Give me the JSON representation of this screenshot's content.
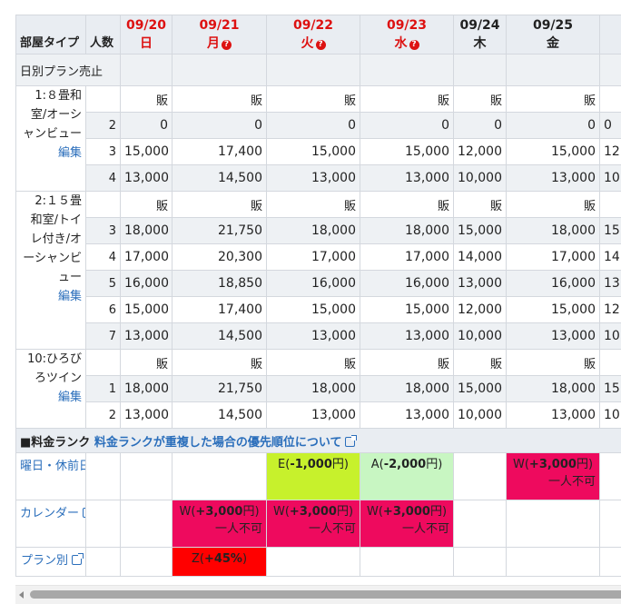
{
  "header": {
    "room_type": "部屋タイプ",
    "persons": "人数",
    "dates": [
      {
        "date": "09/20",
        "weekday": "日",
        "color": "red",
        "has_q": false
      },
      {
        "date": "09/21",
        "weekday": "月",
        "color": "red",
        "has_q": true
      },
      {
        "date": "09/22",
        "weekday": "火",
        "color": "red",
        "has_q": true
      },
      {
        "date": "09/23",
        "weekday": "水",
        "color": "red",
        "has_q": true
      },
      {
        "date": "09/24",
        "weekday": "木",
        "color": "blk",
        "has_q": false
      },
      {
        "date": "09/25",
        "weekday": "金",
        "color": "blk",
        "has_q": false
      },
      {
        "date": "09",
        "weekday": "",
        "color": "blu",
        "has_q": false
      }
    ]
  },
  "daily_plan_label": "日別プラン売止",
  "sell_label": "販",
  "edit_label": "編集",
  "rooms": [
    {
      "name": "1:８畳和室/オーシャンビュー",
      "lines": [
        "1:８畳和",
        "室/オーシ",
        "ャンビュー"
      ],
      "rows": [
        {
          "persons": "2",
          "values": [
            "0",
            "0",
            "0",
            "0",
            "0",
            "0",
            "0"
          ]
        },
        {
          "persons": "3",
          "values": [
            "15,000",
            "17,400",
            "15,000",
            "15,000",
            "12,000",
            "15,000",
            "12"
          ]
        },
        {
          "persons": "4",
          "values": [
            "13,000",
            "14,500",
            "13,000",
            "13,000",
            "10,000",
            "13,000",
            "10"
          ]
        }
      ]
    },
    {
      "name": "2:１５畳和室/トイレ付き/オーシャンビュー",
      "lines": [
        "2:１５畳",
        "和室/トイ",
        "レ付き/オ",
        "ーシャンビ",
        "ュー"
      ],
      "rows": [
        {
          "persons": "3",
          "values": [
            "18,000",
            "21,750",
            "18,000",
            "18,000",
            "15,000",
            "18,000",
            "15"
          ]
        },
        {
          "persons": "4",
          "values": [
            "17,000",
            "20,300",
            "17,000",
            "17,000",
            "14,000",
            "17,000",
            "14"
          ]
        },
        {
          "persons": "5",
          "values": [
            "16,000",
            "18,850",
            "16,000",
            "16,000",
            "13,000",
            "16,000",
            "13"
          ]
        },
        {
          "persons": "6",
          "values": [
            "15,000",
            "17,400",
            "15,000",
            "15,000",
            "12,000",
            "15,000",
            "12"
          ]
        },
        {
          "persons": "7",
          "values": [
            "13,000",
            "14,500",
            "13,000",
            "13,000",
            "10,000",
            "13,000",
            "10"
          ]
        }
      ]
    },
    {
      "name": "10:ひろびろツイン",
      "lines": [
        "10:ひろび",
        "ろツイン"
      ],
      "rows": [
        {
          "persons": "1",
          "values": [
            "18,000",
            "21,750",
            "18,000",
            "18,000",
            "15,000",
            "18,000",
            "15"
          ]
        },
        {
          "persons": "2",
          "values": [
            "13,000",
            "14,500",
            "13,000",
            "13,000",
            "10,000",
            "13,000",
            "10"
          ]
        }
      ]
    }
  ],
  "rank_section": {
    "title": "■料金ランク",
    "link": "料金ランクが重複した場合の優先順位について"
  },
  "rank_rows": [
    {
      "label": "曜日・休前日",
      "cells": [
        null,
        null,
        {
          "text": "E(-1,000円)",
          "bold": "-1,000",
          "pre": "E(",
          "post": "円)",
          "color": "yellow"
        },
        {
          "text": "A(-2,000円)",
          "bold": "-2,000",
          "pre": "A(",
          "post": "円)",
          "color": "lgreen"
        },
        null,
        {
          "text": "W(+3,000円)",
          "bold": "+3,000",
          "pre": "W(",
          "post": "円)",
          "sub": "一人不可",
          "color": "pink"
        },
        null
      ]
    },
    {
      "label": "カレンダー",
      "cells": [
        null,
        {
          "text": "W(+3,000円)",
          "bold": "+3,000",
          "pre": "W(",
          "post": "円)",
          "sub": "一人不可",
          "color": "pink"
        },
        {
          "text": "W(+3,000円)",
          "bold": "+3,000",
          "pre": "W(",
          "post": "円)",
          "sub": "一人不可",
          "color": "pink"
        },
        {
          "text": "W(+3,000円)",
          "bold": "+3,000",
          "pre": "W(",
          "post": "円)",
          "sub": "一人不可",
          "color": "pink"
        },
        null,
        null,
        null
      ]
    },
    {
      "label": "プラン別",
      "cells": [
        null,
        {
          "text": "Z(+45%)",
          "bold": "+45%",
          "pre": "Z(",
          "post": ")",
          "color": "red"
        },
        null,
        null,
        null,
        null,
        null
      ]
    }
  ],
  "colors": {
    "holiday_red": "#dd1111",
    "saturday_blue": "#1a2fc8",
    "link_blue": "#2a6ebb",
    "rank_yellow": "#c7f12c",
    "rank_lgreen": "#c8f6c2",
    "rank_pink": "#ee0a5e",
    "rank_red": "#ff0000"
  }
}
